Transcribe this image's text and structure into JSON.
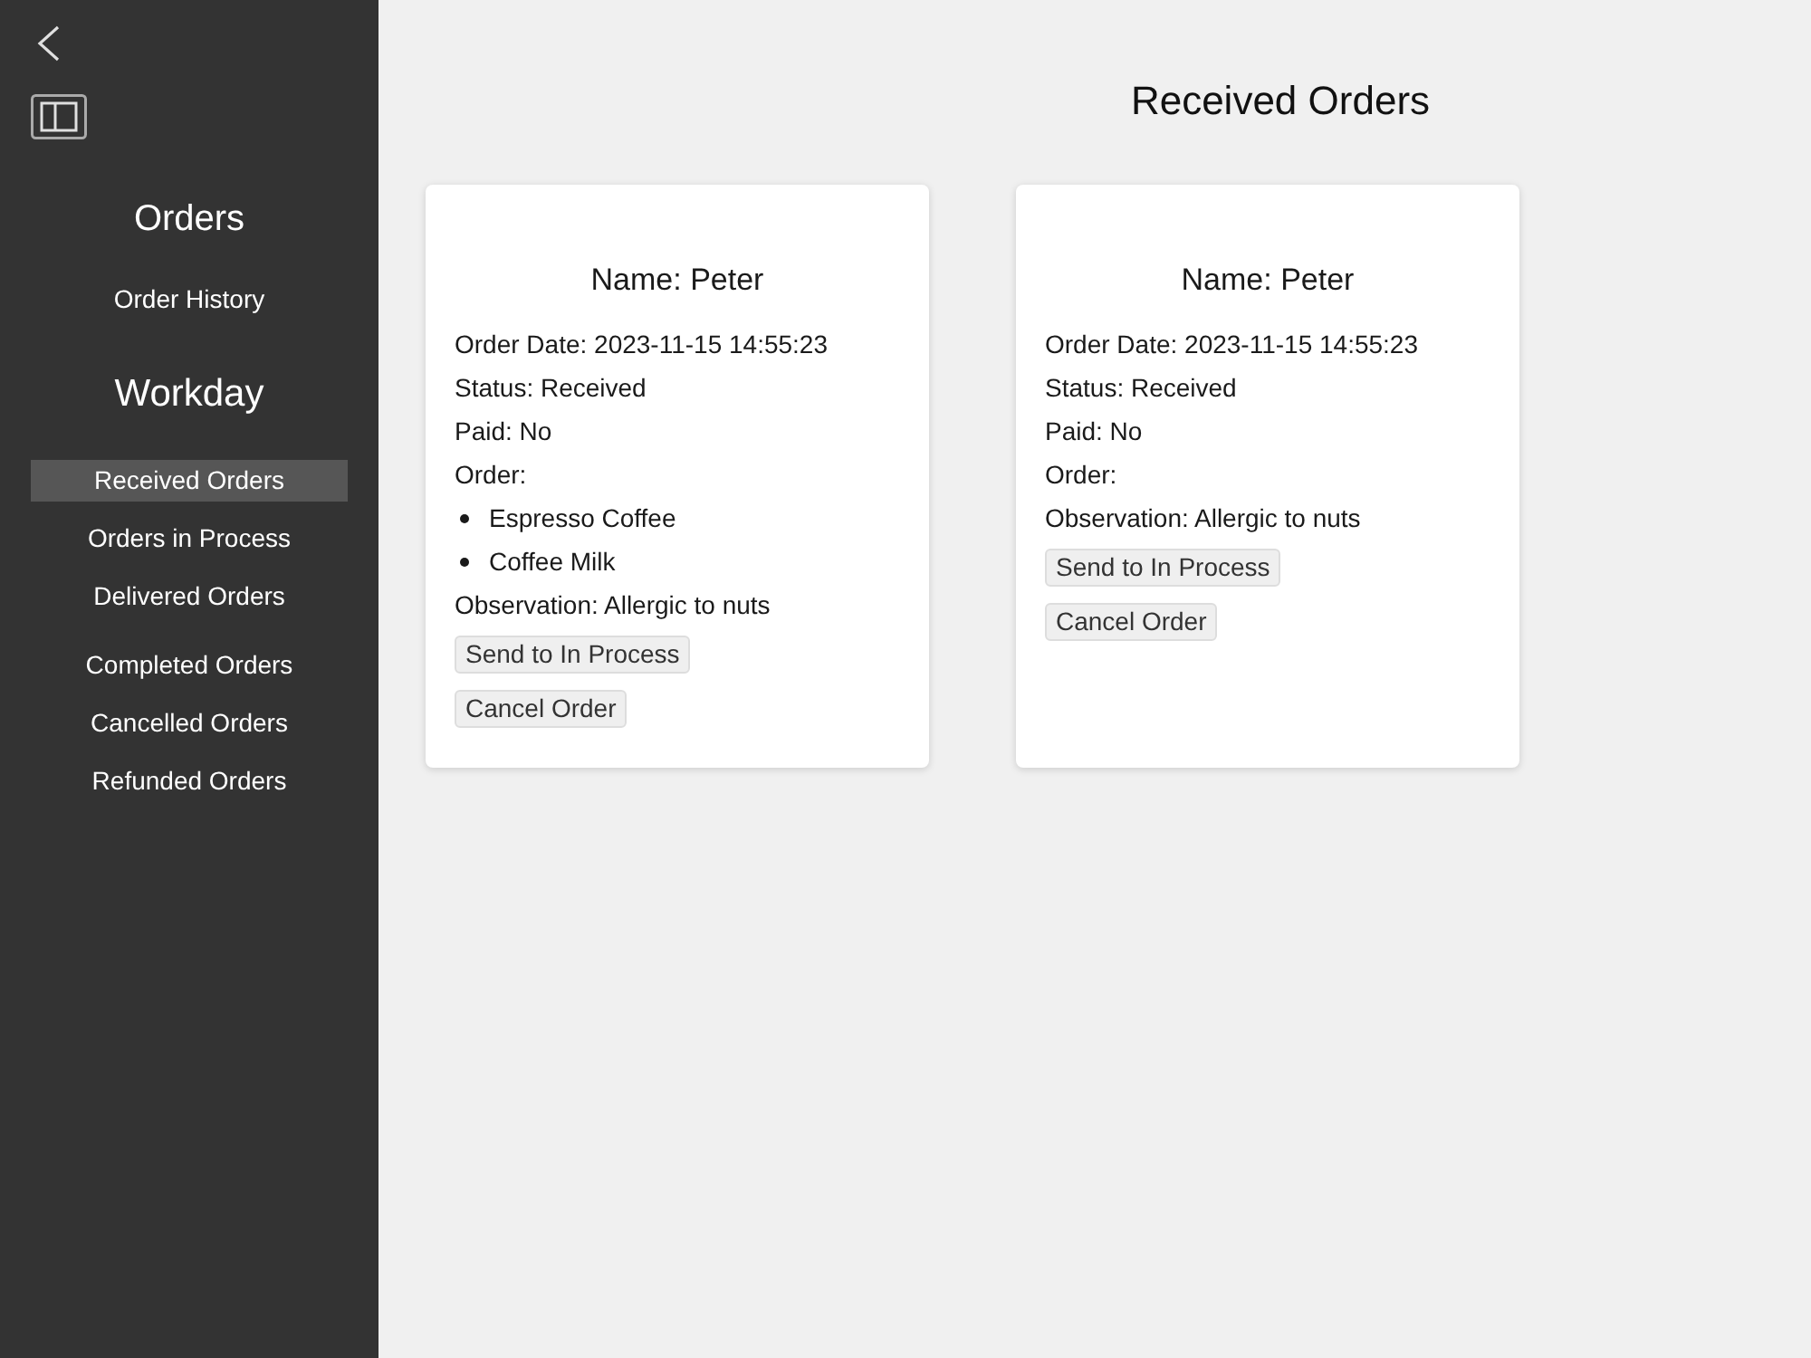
{
  "sidebar": {
    "sections": [
      {
        "title": "Orders",
        "groups": [
          {
            "items": [
              {
                "label": "Order History",
                "selected": false
              }
            ]
          }
        ]
      },
      {
        "title": "Workday",
        "groups": [
          {
            "items": [
              {
                "label": "Received Orders",
                "selected": true
              },
              {
                "label": "Orders in Process",
                "selected": false
              },
              {
                "label": "Delivered Orders",
                "selected": false
              }
            ]
          },
          {
            "items": [
              {
                "label": "Completed Orders",
                "selected": false
              },
              {
                "label": "Cancelled Orders",
                "selected": false
              },
              {
                "label": "Refunded Orders",
                "selected": false
              }
            ]
          }
        ]
      }
    ]
  },
  "main": {
    "title": "Received Orders",
    "orders": [
      {
        "name": "Name: Peter",
        "details": [
          "Order Date: 2023-11-15 14:55:23",
          "Status: Received",
          "Paid: No",
          "Order:"
        ],
        "items": [
          "Espresso Coffee",
          "Coffee Milk"
        ],
        "observation": "Observation: Allergic to nuts",
        "buttons": [
          "Send to In Process",
          "Cancel Order"
        ]
      },
      {
        "name": "Name: Peter",
        "details": [
          "Order Date: 2023-11-15 14:55:23",
          "Status: Received",
          "Paid: No",
          "Order:"
        ],
        "observation": "Observation: Allergic to nuts",
        "buttons": [
          "Send to In Process",
          "Cancel Order"
        ]
      }
    ]
  }
}
